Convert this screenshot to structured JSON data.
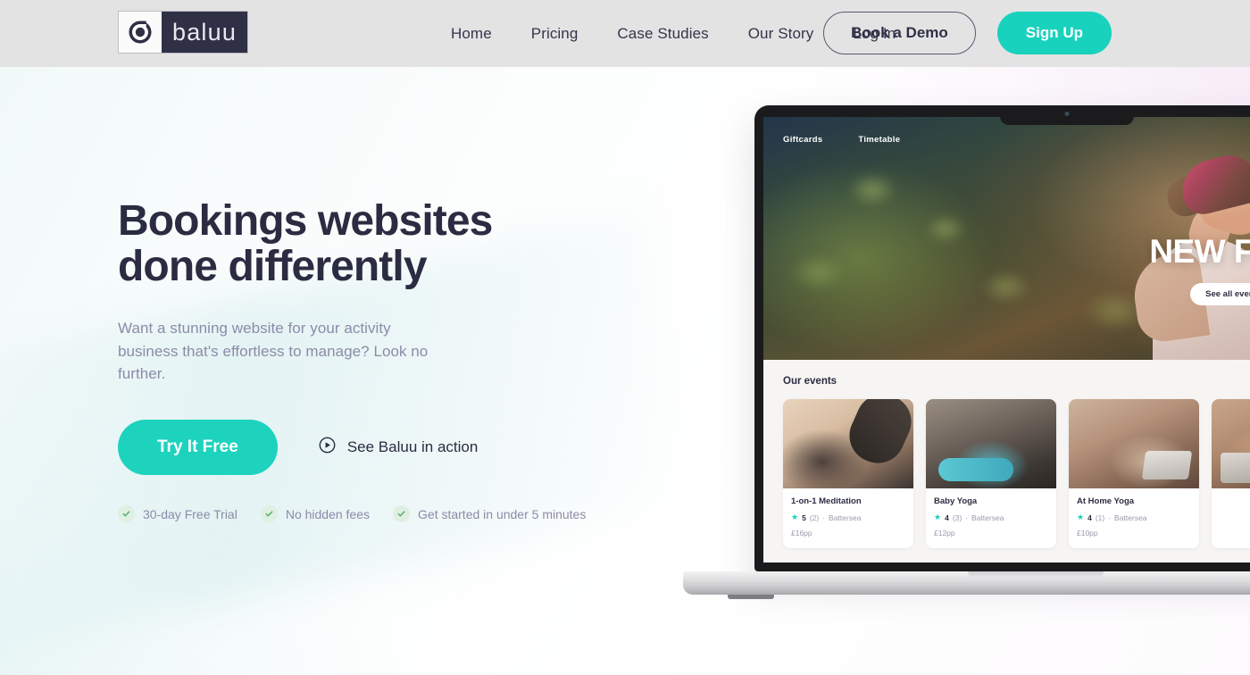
{
  "brand": {
    "name": "baluu",
    "logo_icon": "baluu-circle-mark",
    "accent_teal": "#1dd3bd",
    "dark_navy": "#2b2c41",
    "header_bg": "#e3e3e4"
  },
  "header": {
    "nav": [
      {
        "label": "Home",
        "name": "nav-home"
      },
      {
        "label": "Pricing",
        "name": "nav-pricing"
      },
      {
        "label": "Case Studies",
        "name": "nav-case-studies"
      },
      {
        "label": "Our Story",
        "name": "nav-our-story"
      },
      {
        "label": "Log In",
        "name": "nav-log-in"
      }
    ],
    "book_demo_label": "Book a Demo",
    "sign_up_label": "Sign Up"
  },
  "hero": {
    "heading_line1": "Bookings websites",
    "heading_line2": "done differently",
    "subtitle": "Want a stunning website for your activity business that's effortless to manage? Look no further.",
    "primary_cta": "Try It Free",
    "secondary_cta": "See Baluu in action",
    "secondary_cta_icon": "play-circle-icon",
    "features": [
      {
        "label": "30-day Free Trial",
        "icon": "check-circle-icon"
      },
      {
        "label": "No hidden fees",
        "icon": "check-circle-icon"
      },
      {
        "label": "Get started in under 5 minutes",
        "icon": "check-circle-icon"
      }
    ]
  },
  "mockup": {
    "device": "laptop",
    "site_nav": [
      {
        "label": "Giftcards"
      },
      {
        "label": "Timetable"
      }
    ],
    "site_hero_title": "NEW FLOOM",
    "site_hero_cta": "See all events",
    "events_heading": "Our events",
    "event_cards": [
      {
        "title": "1-on-1 Meditation",
        "rating": "5",
        "reviews": "(2)",
        "separator": "·",
        "location": "Battersea",
        "price": "£16pp",
        "star_icon": "star-icon"
      },
      {
        "title": "Baby Yoga",
        "rating": "4",
        "reviews": "(3)",
        "separator": "·",
        "location": "Battersea",
        "price": "£12pp",
        "star_icon": "star-icon"
      },
      {
        "title": "At Home Yoga",
        "rating": "4",
        "reviews": "(1)",
        "separator": "·",
        "location": "Battersea",
        "price": "£10pp",
        "star_icon": "star-icon"
      },
      {
        "title": "",
        "rating": "",
        "reviews": "",
        "separator": "",
        "location": "",
        "price": "",
        "star_icon": "star-icon"
      }
    ]
  }
}
